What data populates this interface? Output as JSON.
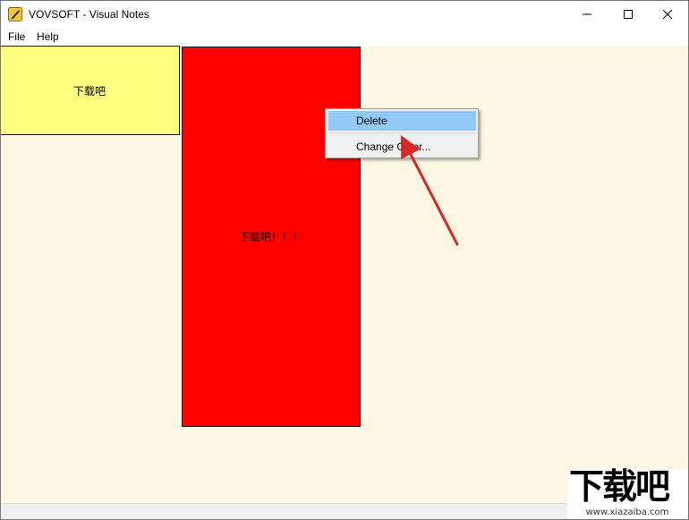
{
  "window": {
    "title": "VOVSOFT - Visual Notes",
    "icon": "pencil-note-icon",
    "controls": {
      "minimize": "minimize-icon",
      "maximize": "maximize-icon",
      "close": "close-icon"
    }
  },
  "menubar": {
    "items": [
      {
        "label": "File"
      },
      {
        "label": "Help"
      }
    ]
  },
  "notes": [
    {
      "text": "下载吧",
      "color": "#ffff80"
    },
    {
      "text": "下载吧！！！",
      "color": "#ff0000"
    }
  ],
  "canvas": {
    "background": "#fdf6e3"
  },
  "context_menu": {
    "items": [
      {
        "label": "Delete",
        "highlighted": true
      },
      {
        "label": "Change Color..."
      }
    ],
    "highlight_color": "#91c9f7"
  },
  "annotation": {
    "arrow_color": "#d62a28"
  },
  "watermark": {
    "text": "下载吧",
    "url": "www.xiazaiba.com"
  }
}
